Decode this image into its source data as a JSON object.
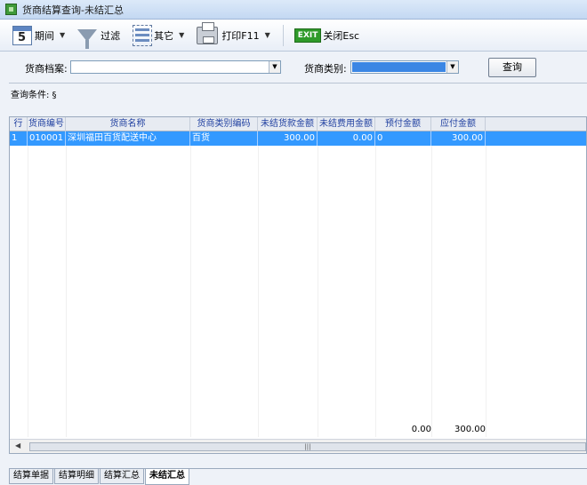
{
  "window": {
    "title": "货商结算查询-未结汇总"
  },
  "toolbar": {
    "period_icon_digit": "5",
    "period_label": "期间",
    "filter_label": "过滤",
    "other_label": "其它",
    "print_label": "打印F11",
    "exit_badge": "EXIT",
    "close_label": "关闭Esc"
  },
  "query": {
    "vendor_label": "货商档案:",
    "vendor_value": "",
    "category_label": "货商类别:",
    "category_value": "",
    "search_button": "查询",
    "conditions_text": "查询条件: §"
  },
  "grid": {
    "columns": [
      "行",
      "货商编号",
      "货商名称",
      "货商类别编码",
      "未结货款金额",
      "未结费用金额",
      "预付金额",
      "应付金额"
    ],
    "rows": [
      [
        "1",
        "010001",
        "深圳福田百货配送中心",
        "百货",
        "300.00",
        "0.00",
        "0",
        "300.00"
      ]
    ],
    "totals": {
      "unsettled_fee": "0.00",
      "payable": "300.00"
    }
  },
  "tabs": [
    {
      "label": "结算单据",
      "active": false
    },
    {
      "label": "结算明细",
      "active": false
    },
    {
      "label": "结算汇总",
      "active": false
    },
    {
      "label": "未结汇总",
      "active": true
    }
  ]
}
